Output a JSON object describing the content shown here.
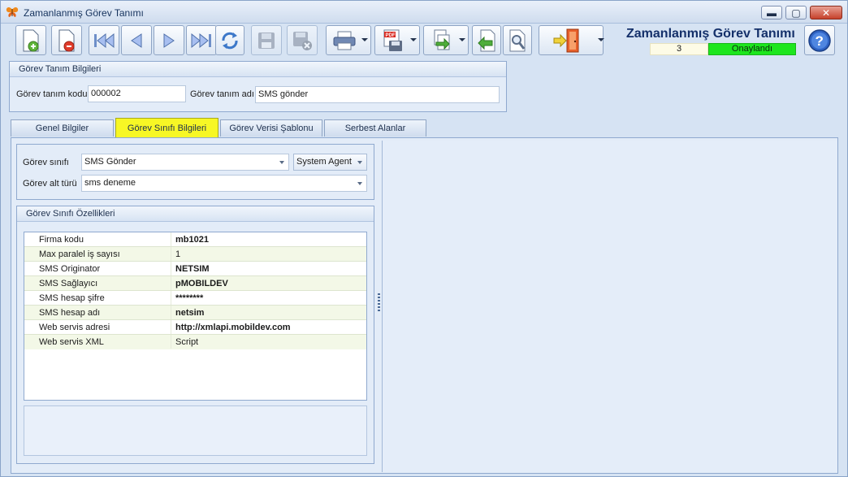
{
  "window": {
    "title": "Zamanlanmış Görev Tanımı",
    "buttons": {
      "minimize": "▬",
      "maximize": "▢",
      "close": "✕"
    }
  },
  "toolbar": {
    "buttons": [
      {
        "name": "new-record-icon"
      },
      {
        "name": "delete-record-icon"
      },
      {
        "name": "first-record-icon"
      },
      {
        "name": "previous-record-icon"
      },
      {
        "name": "next-record-icon"
      },
      {
        "name": "last-record-icon"
      },
      {
        "name": "refresh-icon"
      },
      {
        "name": "save-icon"
      },
      {
        "name": "save-close-icon"
      },
      {
        "name": "print-icon"
      },
      {
        "name": "pdf-export-icon"
      },
      {
        "name": "export-icon"
      },
      {
        "name": "import-icon"
      },
      {
        "name": "search-tool-icon"
      },
      {
        "name": "exit-door-icon"
      }
    ]
  },
  "header": {
    "title": "Zamanlanmış Görev Tanımı",
    "record_number": "3",
    "status": "Onaylandı",
    "status_color": "#1ee61e"
  },
  "task_info": {
    "group_title": "Görev Tanım Bilgileri",
    "code_label": "Görev tanım kodu",
    "code_value": "000002",
    "name_label": "Görev tanım adı",
    "name_value": "SMS gönder"
  },
  "tabs": [
    {
      "label": "Genel Bilgiler",
      "active": false
    },
    {
      "label": "Görev Sınıfı Bilgileri",
      "active": true
    },
    {
      "label": "Görev Verisi Şablonu",
      "active": false
    },
    {
      "label": "Serbest Alanlar",
      "active": false
    }
  ],
  "class_info": {
    "class_label": "Görev sınıfı",
    "class_value": "SMS Gönder",
    "agent_value": "System Agent",
    "subtype_label": "Görev alt türü",
    "subtype_value": "sms deneme"
  },
  "properties": {
    "group_title": "Görev Sınıfı Özellikleri",
    "rows": [
      {
        "key": "Firma kodu",
        "value": "mb1021",
        "bold": true
      },
      {
        "key": "Max paralel iş sayısı",
        "value": "1",
        "bold": false
      },
      {
        "key": "SMS Originator",
        "value": "NETSIM",
        "bold": true
      },
      {
        "key": "SMS Sağlayıcı",
        "value": "pMOBILDEV",
        "bold": true
      },
      {
        "key": "SMS hesap şifre",
        "value": "********",
        "bold": true
      },
      {
        "key": "SMS hesap adı",
        "value": "netsim",
        "bold": true
      },
      {
        "key": "Web servis adresi",
        "value": "http://xmlapi.mobildev.com",
        "bold": true
      },
      {
        "key": "Web servis XML",
        "value": "Script",
        "bold": false
      }
    ]
  },
  "colors": {
    "active_tab": "#f7f725",
    "title_text": "#14306a"
  }
}
